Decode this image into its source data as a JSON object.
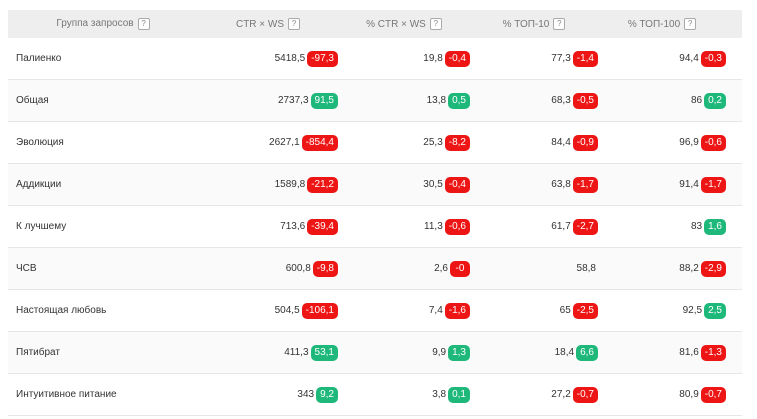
{
  "header": {
    "name": "Группа запросов",
    "ctr_ws": "CTR × WS",
    "pct_ctr_ws": "% CTR × WS",
    "pct_top10": "% ТОП-10",
    "pct_top100": "% ТОП-100",
    "help_glyph": "?"
  },
  "colors": {
    "negative_badge": "#ee1515",
    "positive_badge": "#1eb87a",
    "header_bg": "#eeeeee"
  },
  "rows": [
    {
      "name": "Палиенко",
      "ctr": "5418,5",
      "ctr_d": "-97,3",
      "ctr_s": "neg",
      "pctr": "19,8",
      "pctr_d": "-0,4",
      "pctr_s": "neg",
      "t10": "77,3",
      "t10_d": "-1,4",
      "t10_s": "neg",
      "t100": "94,4",
      "t100_d": "-0,3",
      "t100_s": "neg"
    },
    {
      "name": "Общая",
      "ctr": "2737,3",
      "ctr_d": "91,5",
      "ctr_s": "pos",
      "pctr": "13,8",
      "pctr_d": "0,5",
      "pctr_s": "pos",
      "t10": "68,3",
      "t10_d": "-0,5",
      "t10_s": "neg",
      "t100": "86",
      "t100_d": "0,2",
      "t100_s": "pos"
    },
    {
      "name": "Эволюция",
      "ctr": "2627,1",
      "ctr_d": "-854,4",
      "ctr_s": "neg",
      "pctr": "25,3",
      "pctr_d": "-8,2",
      "pctr_s": "neg",
      "t10": "84,4",
      "t10_d": "-0,9",
      "t10_s": "neg",
      "t100": "96,9",
      "t100_d": "-0,6",
      "t100_s": "neg"
    },
    {
      "name": "Аддикции",
      "ctr": "1589,8",
      "ctr_d": "-21,2",
      "ctr_s": "neg",
      "pctr": "30,5",
      "pctr_d": "-0,4",
      "pctr_s": "neg",
      "t10": "63,8",
      "t10_d": "-1,7",
      "t10_s": "neg",
      "t100": "91,4",
      "t100_d": "-1,7",
      "t100_s": "neg"
    },
    {
      "name": "К лучшему",
      "ctr": "713,6",
      "ctr_d": "-39,4",
      "ctr_s": "neg",
      "pctr": "11,3",
      "pctr_d": "-0,6",
      "pctr_s": "neg",
      "t10": "61,7",
      "t10_d": "-2,7",
      "t10_s": "neg",
      "t100": "83",
      "t100_d": "1,6",
      "t100_s": "pos"
    },
    {
      "name": "ЧСВ",
      "ctr": "600,8",
      "ctr_d": "-9,8",
      "ctr_s": "neg",
      "pctr": "2,6",
      "pctr_d": "-0",
      "pctr_s": "neg",
      "t10": "58,8",
      "t10_d": "",
      "t10_s": "none",
      "t100": "88,2",
      "t100_d": "-2,9",
      "t100_s": "neg"
    },
    {
      "name": "Настоящая любовь",
      "ctr": "504,5",
      "ctr_d": "-106,1",
      "ctr_s": "neg",
      "pctr": "7,4",
      "pctr_d": "-1,6",
      "pctr_s": "neg",
      "t10": "65",
      "t10_d": "-2,5",
      "t10_s": "neg",
      "t100": "92,5",
      "t100_d": "2,5",
      "t100_s": "pos"
    },
    {
      "name": "Пятибрат",
      "ctr": "411,3",
      "ctr_d": "53,1",
      "ctr_s": "pos",
      "pctr": "9,9",
      "pctr_d": "1,3",
      "pctr_s": "pos",
      "t10": "18,4",
      "t10_d": "6,6",
      "t10_s": "pos",
      "t100": "81,6",
      "t100_d": "-1,3",
      "t100_s": "neg"
    },
    {
      "name": "Интуитивное питание",
      "ctr": "343",
      "ctr_d": "9,2",
      "ctr_s": "pos",
      "pctr": "3,8",
      "pctr_d": "0,1",
      "pctr_s": "pos",
      "t10": "27,2",
      "t10_d": "-0,7",
      "t10_s": "neg",
      "t100": "80,9",
      "t100_d": "-0,7",
      "t100_s": "neg"
    }
  ]
}
